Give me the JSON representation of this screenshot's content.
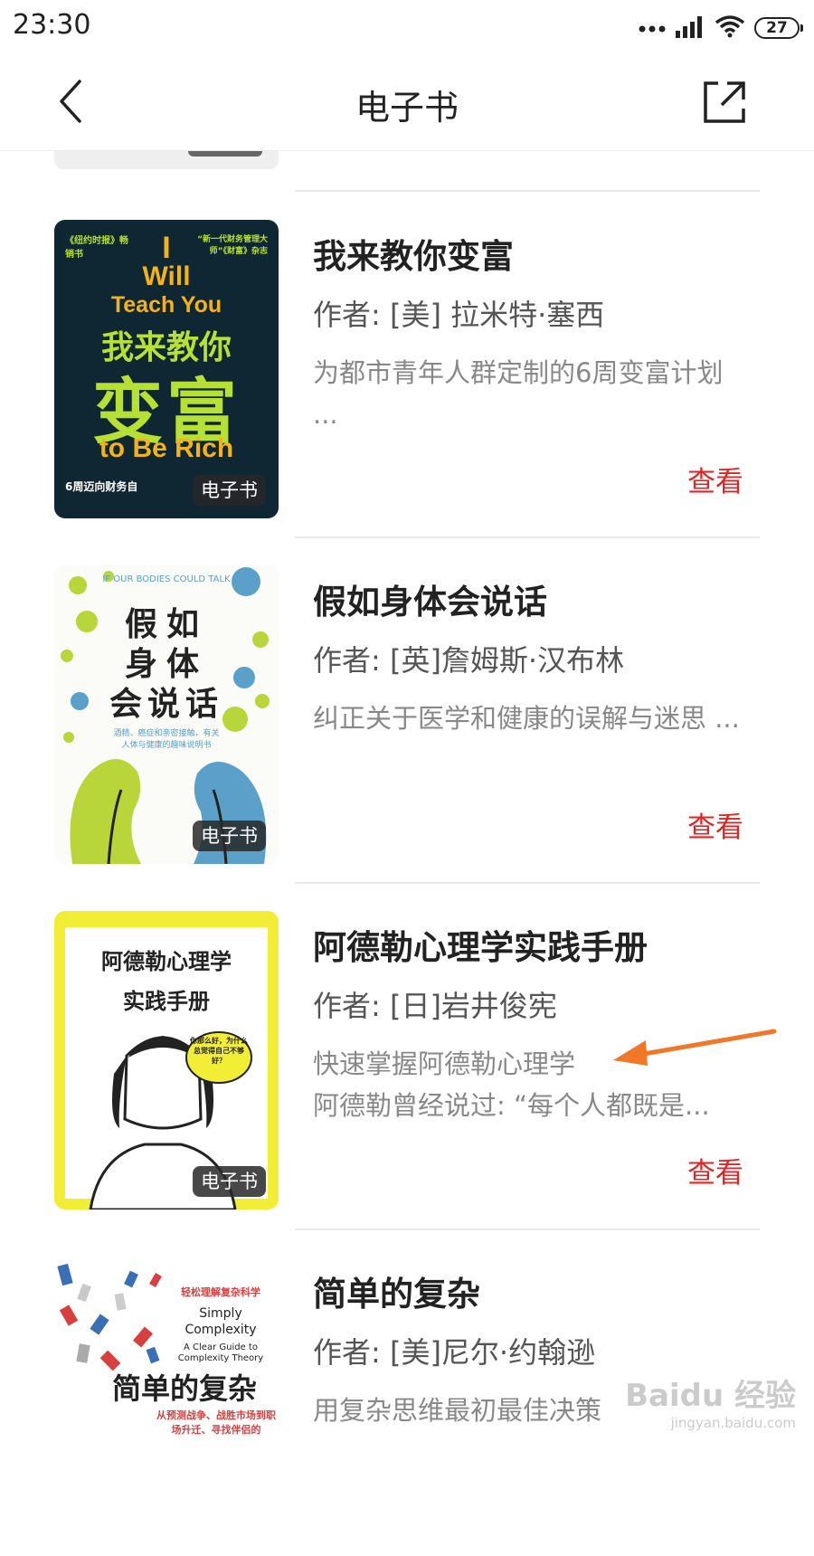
{
  "status_bar": {
    "time": "23:30",
    "battery": "27"
  },
  "nav": {
    "title": "电子书"
  },
  "books": [
    {
      "title": "我来教你变富",
      "author": "作者: [美] 拉米特·塞西",
      "description": "为都市青年人群定制的6周变富计划 ...",
      "tag": "电子书",
      "view": "查看",
      "cover": {
        "top_left": "《纽约时报》畅销书",
        "top_right": "“新一代财务管理大师”《财富》杂志",
        "line1": "I",
        "line2": "Will",
        "line3": "Teach You",
        "line4": "我来教你",
        "line5": "变富",
        "line6": "to Be Rich",
        "bottom": "6周迈向财务自"
      }
    },
    {
      "title": "假如身体会说话",
      "author": "作者: [英]詹姆斯·汉布林",
      "description": "纠正关于医学和健康的误解与迷思 ...",
      "tag": "电子书",
      "view": "查看",
      "cover": {
        "top": "IF OUR BODIES COULD TALK",
        "line1": "假如",
        "line2": "身体",
        "line3": "会说话",
        "sub": "酒精、癌症和亲密接触，有关人体与健康的趣味说明书"
      }
    },
    {
      "title": "阿德勒心理学实践手册",
      "author": "作者: [日]岩井俊宪",
      "description_line1": "快速掌握阿德勒心理学",
      "description_line2": "阿德勒曾经说过: “每个人都既是...",
      "tag": "电子书",
      "view": "查看",
      "cover": {
        "line1": "阿德勒心理学",
        "line2": "实践手册",
        "bubble": "你那么好，为什么总觉得自己不够好？"
      }
    },
    {
      "title": "简单的复杂",
      "author": "作者: [美]尼尔·约翰逊",
      "description": "用复杂思维最初最佳决策",
      "cover": {
        "top": "轻松理解复杂科学",
        "line1": "Simply",
        "line2": "Complexity",
        "line3": "A Clear Guide to",
        "line4": "Complexity Theory",
        "cn_title": "简单的复杂",
        "sub": "从预测战争、战胜市场到职场升迁、寻找伴侣的"
      }
    }
  ],
  "watermark": {
    "main": "Baidu 经验",
    "sub": "jingyan.baidu.com"
  },
  "colors": {
    "accent": "#e02323",
    "arrow": "#f07828",
    "cover3_yellow": "#f2ee35",
    "cover1_green": "#b6e033"
  }
}
